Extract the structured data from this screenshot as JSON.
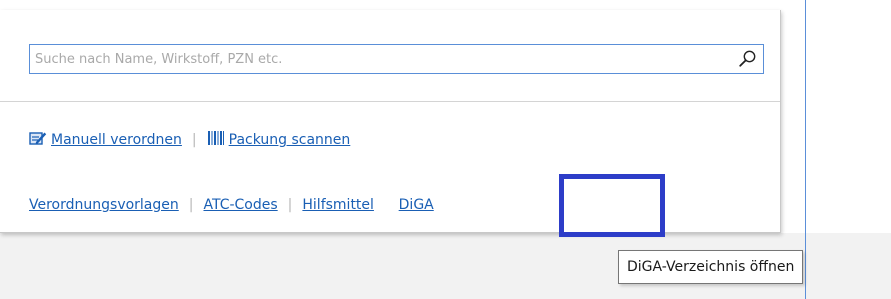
{
  "search": {
    "placeholder": "Suche nach Name, Wirkstoff, PZN etc.",
    "icon": "search-icon"
  },
  "actions": [
    {
      "label": "Manuell verordnen",
      "icon": "edit-icon"
    },
    {
      "label": "Packung scannen",
      "icon": "barcode-icon"
    }
  ],
  "links": [
    {
      "label": "Verordnungsvorlagen"
    },
    {
      "label": "ATC-Codes"
    },
    {
      "label": "Hilfsmittel"
    },
    {
      "label": "DiGA"
    }
  ],
  "separator": "|",
  "tooltip": {
    "text": "DiGA-Verzeichnis öffnen"
  },
  "colors": {
    "link": "#1a5fb4",
    "focus_accent": "#2d3dc8",
    "search_border": "#5a8fd8"
  }
}
